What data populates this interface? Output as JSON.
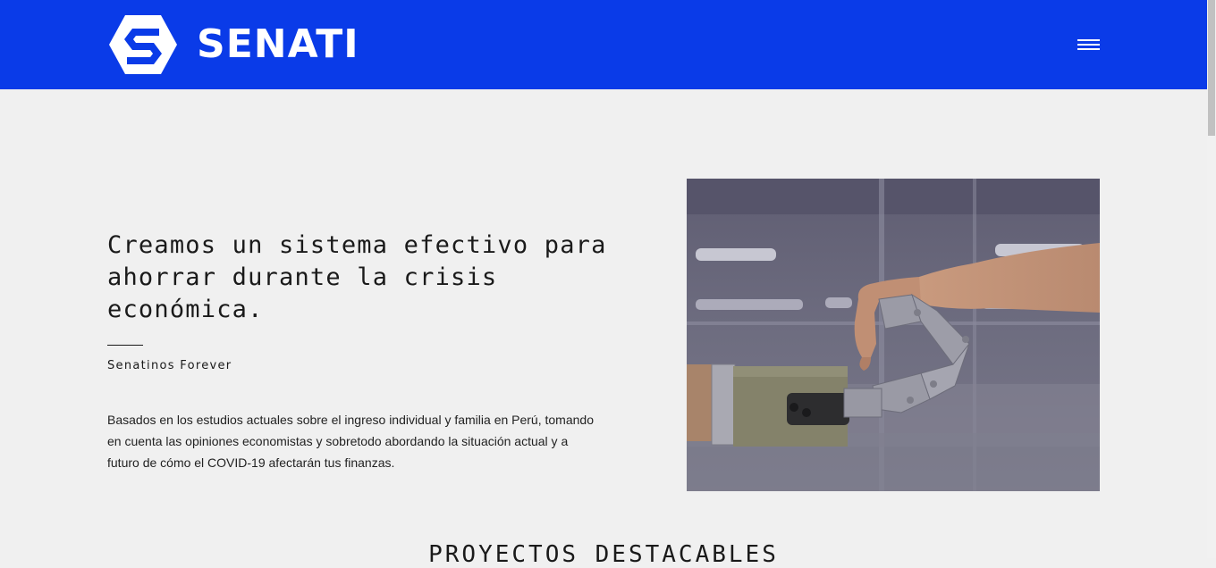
{
  "header": {
    "brand": "SENATI",
    "logo_icon": "senati-hexagon-s-logo",
    "menu_icon": "hamburger-menu-icon",
    "background_color": "#0a3be8"
  },
  "hero": {
    "title": "Creamos un sistema efectivo para ahorrar durante la crisis económica.",
    "subtitle": "Senatinos Forever",
    "description": "Basados en los estudios actuales sobre el ingreso individual y familia en Perú, tomando en cuenta las opiniones economistas y sobretodo abordando la situación actual y a futuro de cómo el COVID-19 afectarán tus finanzas.",
    "image": "robotic-gripper-holding-human-hand-photo"
  },
  "section": {
    "title": "PROYECTOS DESTACABLES"
  }
}
